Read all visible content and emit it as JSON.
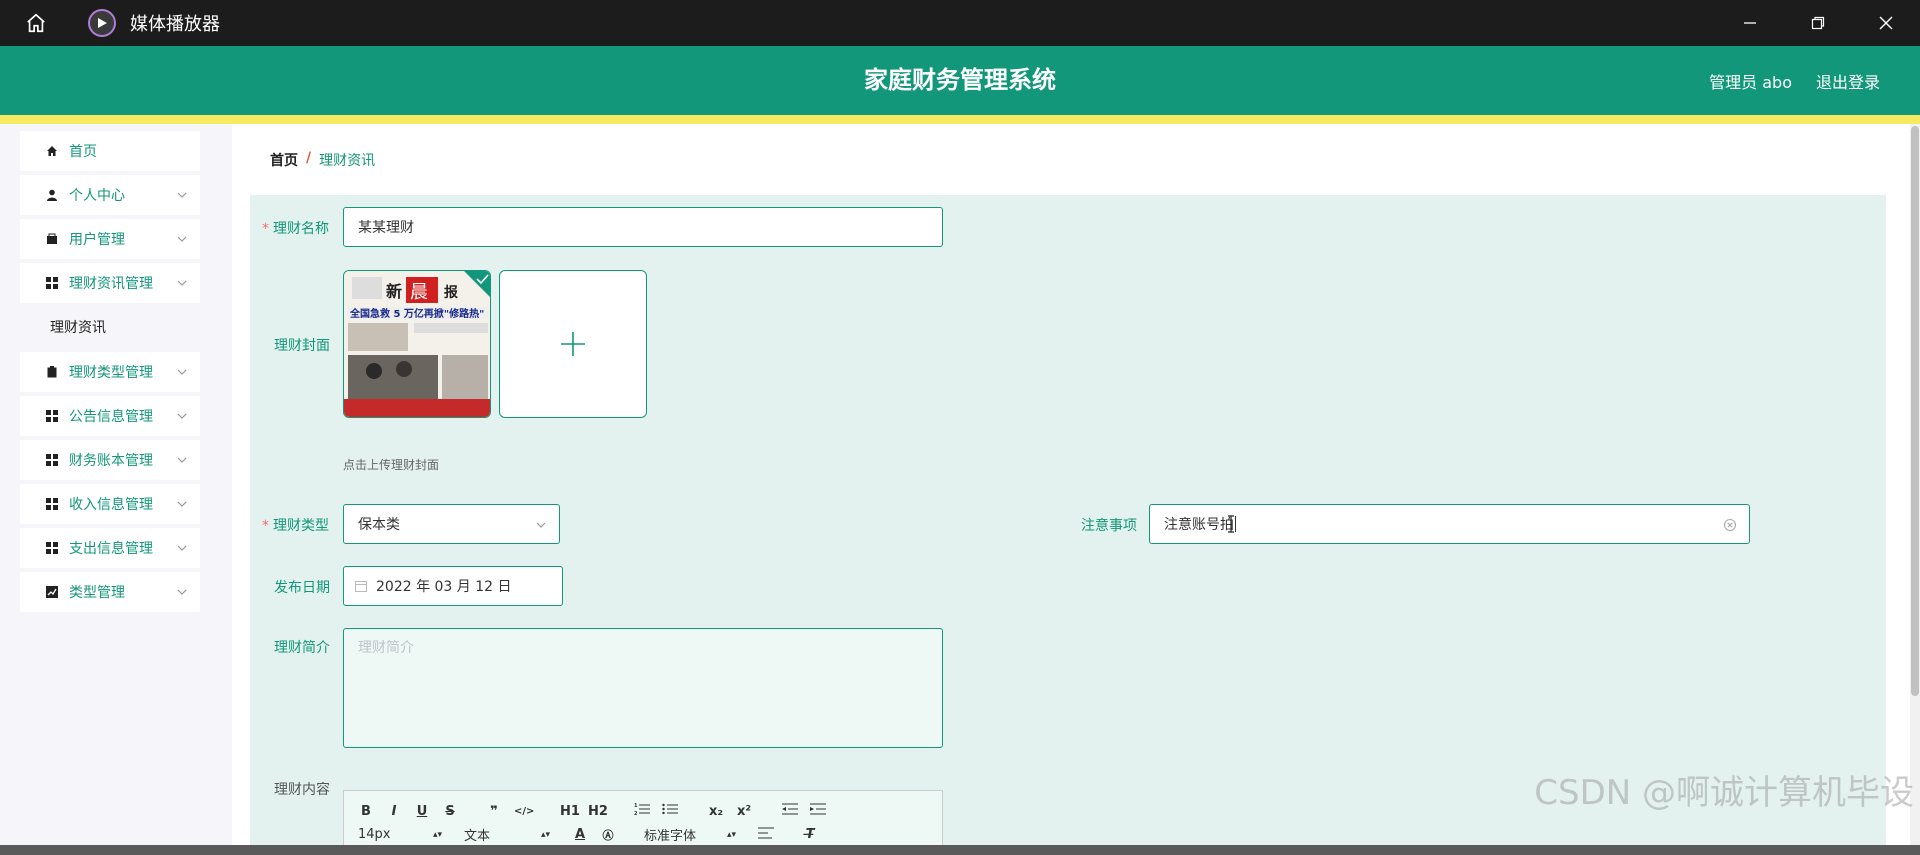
{
  "window": {
    "title": "媒体播放器"
  },
  "header": {
    "title": "家庭财务管理系统",
    "user": "管理员 abo",
    "logout": "退出登录"
  },
  "sidebar": {
    "items": [
      {
        "label": "首页",
        "icon": "home-icon"
      },
      {
        "label": "个人中心",
        "icon": "person-icon"
      },
      {
        "label": "用户管理",
        "icon": "wallet-icon"
      },
      {
        "label": "理财资讯管理",
        "icon": "grid-icon"
      },
      {
        "label": "理财类型管理",
        "icon": "clipboard-icon"
      },
      {
        "label": "公告信息管理",
        "icon": "grid-icon"
      },
      {
        "label": "财务账本管理",
        "icon": "grid-icon"
      },
      {
        "label": "收入信息管理",
        "icon": "grid-icon"
      },
      {
        "label": "支出信息管理",
        "icon": "grid-icon"
      },
      {
        "label": "类型管理",
        "icon": "chart-icon"
      }
    ],
    "subitem": "理财资讯"
  },
  "breadcrumb": {
    "home": "首页",
    "sep": "/",
    "current": "理财资讯"
  },
  "form": {
    "name_label": "理财名称",
    "name_value": "某某理财",
    "cover_label": "理财封面",
    "cover_hint": "点击上传理财封面",
    "type_label": "理财类型",
    "type_value": "保本类",
    "notice_label": "注意事项",
    "notice_value": "注意账号拍",
    "date_label": "发布日期",
    "date_value": "2022 年 03 月 12 日",
    "intro_label": "理财简介",
    "intro_placeholder": "理财简介",
    "content_label": "理财内容"
  },
  "editor": {
    "row1": [
      "B",
      "I",
      "U",
      "S",
      "❞",
      "</>",
      "H1",
      "H2",
      "ol",
      "ul",
      "x₂",
      "x²",
      "outdent",
      "indent"
    ],
    "size": "14px",
    "format": "文本",
    "font": "标准字体"
  },
  "watermark": "CSDN @啊诚计算机毕设",
  "colors": {
    "primary": "#13977a",
    "accent": "#f7ea63"
  }
}
